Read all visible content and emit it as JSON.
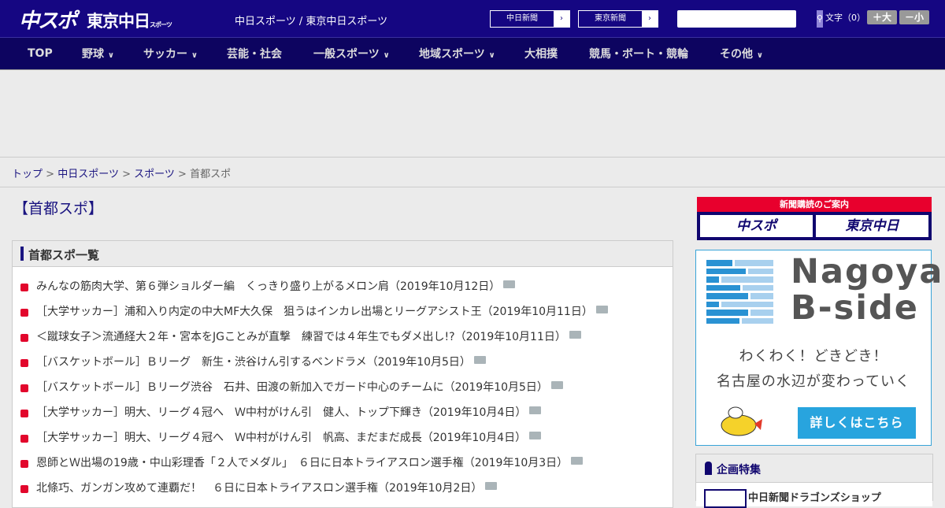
{
  "header": {
    "logo_chuspo": "中スポ",
    "logo_tokyo": "東京中日",
    "logo_tokyo_small": "スポーツ",
    "site_name": "中日スポーツ / 東京中日スポーツ",
    "links": [
      "中日新聞",
      "東京新聞"
    ],
    "search_placeholder": "",
    "font_label": "文字（0）",
    "font_up": "＋大",
    "font_down": "－小"
  },
  "nav": [
    {
      "label": "TOP",
      "dropdown": false
    },
    {
      "label": "野球",
      "dropdown": true
    },
    {
      "label": "サッカー",
      "dropdown": true
    },
    {
      "label": "芸能・社会",
      "dropdown": false
    },
    {
      "label": "一般スポーツ",
      "dropdown": true
    },
    {
      "label": "地域スポーツ",
      "dropdown": true
    },
    {
      "label": "大相撲",
      "dropdown": false
    },
    {
      "label": "競馬・ボート・競輪",
      "dropdown": false
    },
    {
      "label": "その他",
      "dropdown": true
    }
  ],
  "breadcrumb": {
    "items": [
      "トップ",
      "中日スポーツ",
      "スポーツ"
    ],
    "current": "首都スポ",
    "sep": ">"
  },
  "page_title": "【首都スポ】",
  "list": {
    "title": "首都スポ一覧",
    "items": [
      "みんなの筋肉大学、第６弾ショルダー編　くっきり盛り上がるメロン肩（2019年10月12日）",
      "［大学サッカー］浦和入り内定の中大MF大久保　狙うはインカレ出場とリーグアシスト王（2019年10月11日）",
      "＜蹴球女子＞流通経大２年・宮本をJGことみが直撃　練習では４年生でもダメ出し!?（2019年10月11日）",
      "［バスケットボール］Ｂリーグ　新生・渋谷けん引するベンドラメ（2019年10月5日）",
      "［バスケットボール］Ｂリーグ渋谷　石井、田渡の新加入でガード中心のチームに（2019年10月5日）",
      "［大学サッカー］明大、リーグ４冠へ　Ｗ中村がけん引　健人、トップ下輝き（2019年10月4日）",
      "［大学サッカー］明大、リーグ４冠へ　Ｗ中村がけん引　帆高、まだまだ成長（2019年10月4日）",
      "恩師とＷ出場の19歳・中山彩理香「２人でメダル」　６日に日本トライアスロン選手権（2019年10月3日）",
      "北條巧、ガンガン攻めて連覇だ！　６日に日本トライアスロン選手権（2019年10月2日）"
    ]
  },
  "sidebar": {
    "subscribe_title": "新聞購読のご案内",
    "subscribe_chuspo": "中スポ",
    "subscribe_tokyo": "東京中日",
    "bside": {
      "title1": "Nagoya",
      "title2": "B-side",
      "copy1": "わくわく！どきどき！",
      "copy2": "名古屋の水辺が変わっていく",
      "button": "詳しくはこちら"
    },
    "kikaku": {
      "title": "企画特集",
      "item": "中日新聞ドラゴンズショップ"
    }
  },
  "colors": {
    "header": "#150682",
    "nav": "#0d0460",
    "accent_red": "#e2062c",
    "bside_blue": "#28a4de"
  }
}
